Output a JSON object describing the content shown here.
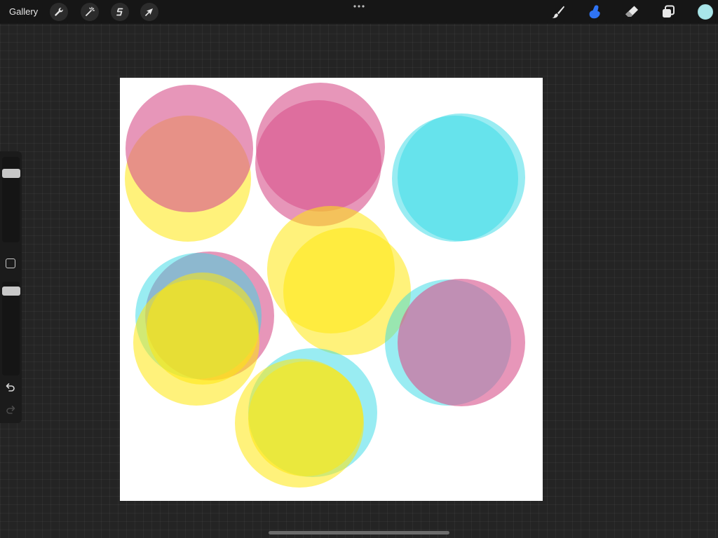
{
  "topbar": {
    "gallery_label": "Gallery",
    "left_tools": [
      {
        "name": "actions",
        "icon": "wrench-icon"
      },
      {
        "name": "adjustments",
        "icon": "magic-wand-icon"
      },
      {
        "name": "selection",
        "icon": "selection-s-icon"
      },
      {
        "name": "transform",
        "icon": "arrow-cursor-icon"
      }
    ],
    "more_icon": "ellipsis-icon",
    "right_tools": [
      {
        "name": "brush",
        "icon": "brush-icon",
        "active": false
      },
      {
        "name": "smudge",
        "icon": "smudge-finger-icon",
        "active": true
      },
      {
        "name": "eraser",
        "icon": "eraser-icon",
        "active": false
      },
      {
        "name": "layers",
        "icon": "layers-icon",
        "active": false
      }
    ],
    "current_color": "#a9e6ea"
  },
  "colors": {
    "magenta": "#d9558e",
    "yellow": "#ffe70f",
    "cyan": "#33d9e6",
    "active_tool": "#2f74f5"
  },
  "sidebar": {
    "brush_size_level": 0.16,
    "opacity_level": 0.06,
    "modify_icon": "square-modify-icon",
    "undo_icon": "undo-icon",
    "redo_icon": "redo-icon"
  }
}
